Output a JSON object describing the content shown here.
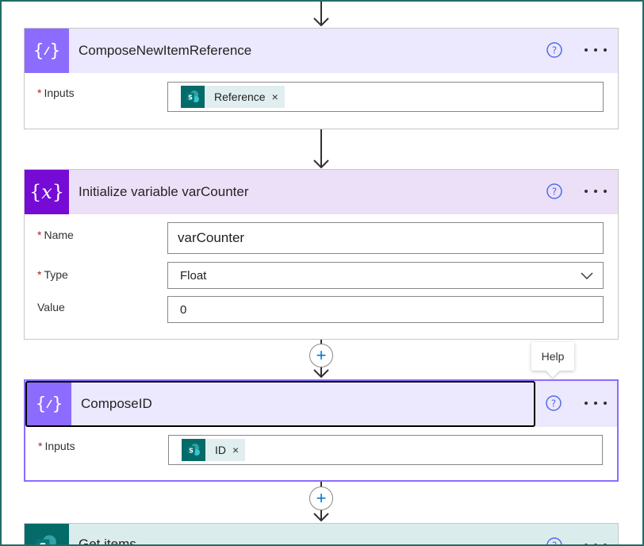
{
  "colors": {
    "compose_header": "#ece8fd",
    "compose_icon_bg": "#8c6cff",
    "variable_header": "#ece0f8",
    "variable_icon_bg": "#770bd6",
    "sharepoint_header": "#dbecec",
    "sharepoint_icon_bg": "#046b69",
    "selected_border": "#8c6cff"
  },
  "cards": {
    "compose_new_item": {
      "title": "ComposeNewItemReference",
      "icon": "compose-braces-icon",
      "inputs_label": "Inputs",
      "token_label": "Reference",
      "token_remove": "×"
    },
    "init_variable": {
      "title": "Initialize variable varCounter",
      "icon": "variable-x-icon",
      "name_label": "Name",
      "name_value": "varCounter",
      "type_label": "Type",
      "type_value": "Float",
      "value_label": "Value",
      "value_value": "0"
    },
    "compose_id": {
      "title": "ComposeID",
      "icon": "compose-braces-icon",
      "inputs_label": "Inputs",
      "token_label": "ID",
      "token_remove": "×"
    },
    "get_items": {
      "title": "Get items",
      "icon": "sharepoint-icon"
    }
  },
  "required_marker": "*",
  "tooltip": {
    "text": "Help"
  },
  "add_step": "+"
}
